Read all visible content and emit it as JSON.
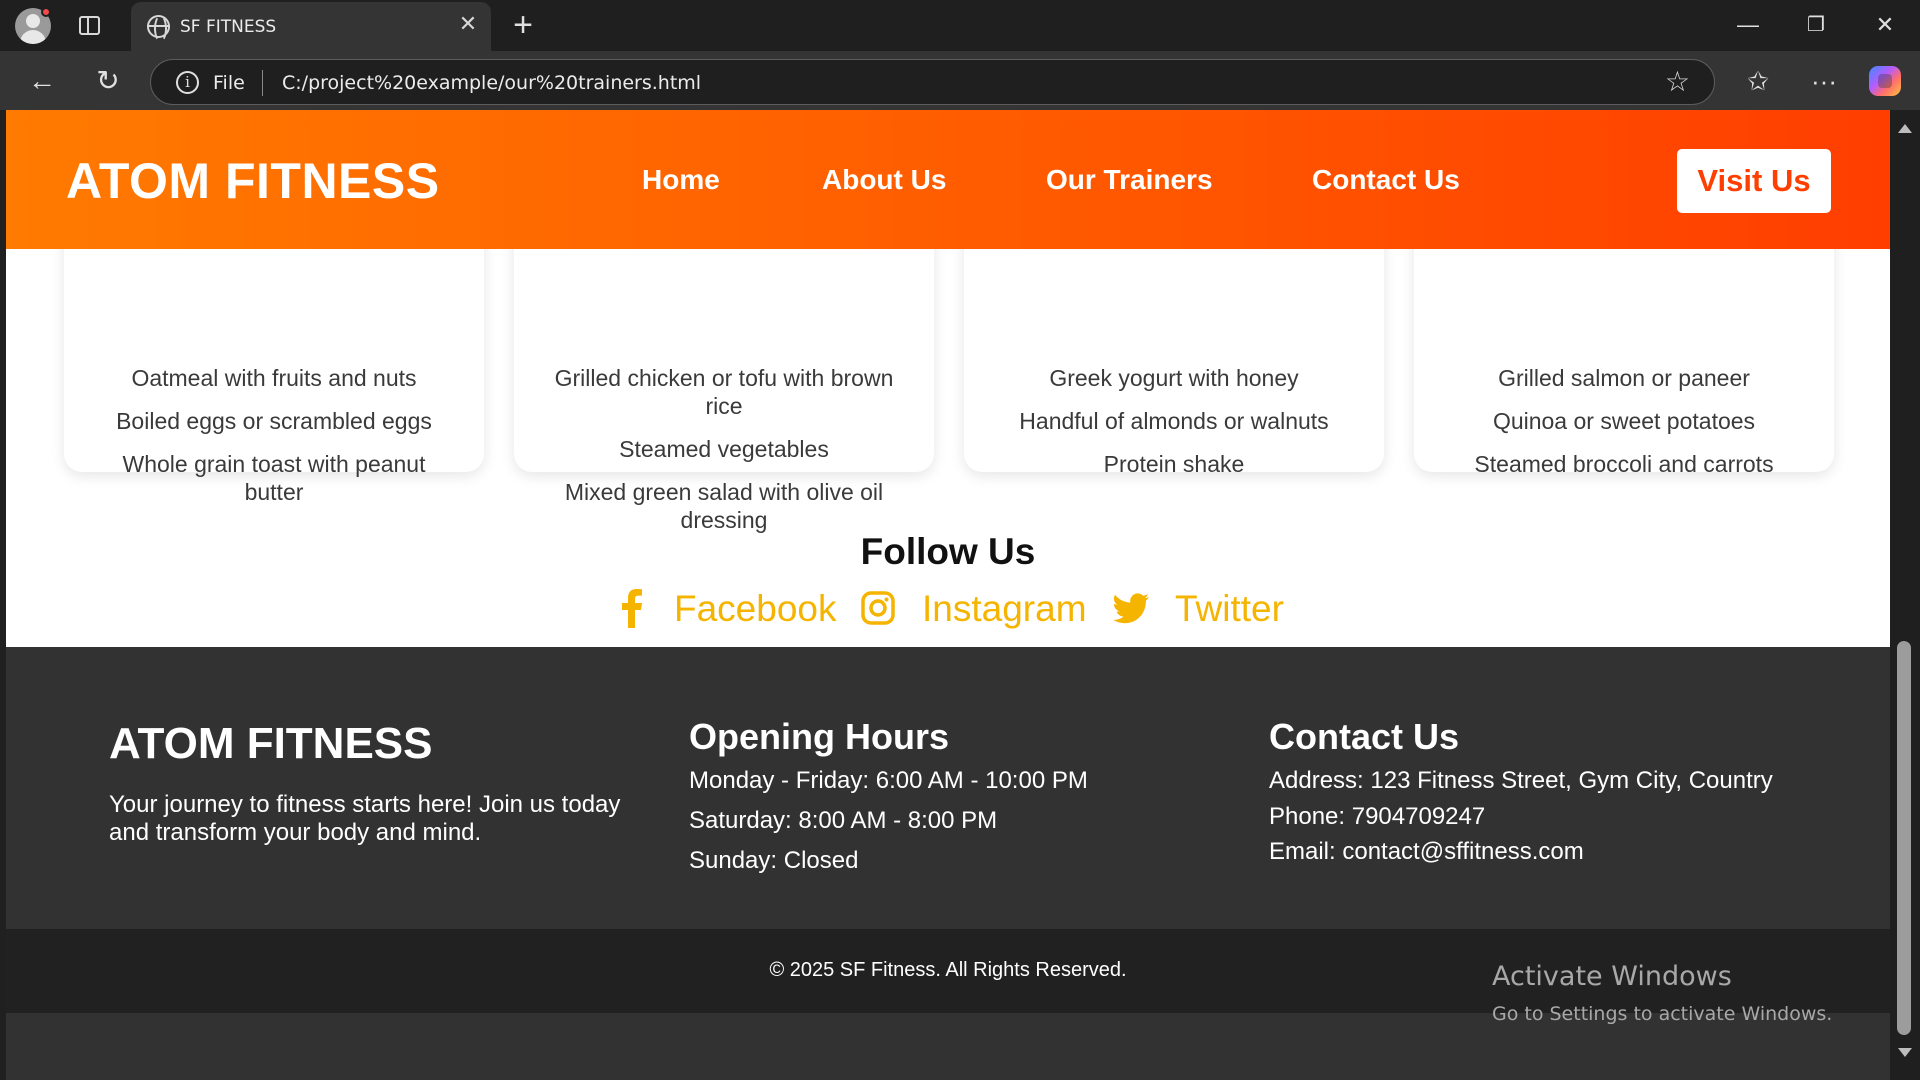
{
  "browser": {
    "tab_title": "SF FITNESS",
    "url_scheme": "File",
    "url": "C:/project%20example/our%20trainers.html"
  },
  "header": {
    "brand": "ATOM FITNESS",
    "nav": [
      "Home",
      "About Us",
      "Our Trainers",
      "Contact Us"
    ],
    "cta": "Visit Us"
  },
  "meal_cards": [
    {
      "items": [
        "Oatmeal with fruits and nuts",
        "Boiled eggs or scrambled eggs",
        "Whole grain toast with peanut butter"
      ]
    },
    {
      "items": [
        "Grilled chicken or tofu with brown rice",
        "Steamed vegetables",
        "Mixed green salad with olive oil dressing"
      ]
    },
    {
      "items": [
        "Greek yogurt with honey",
        "Handful of almonds or walnuts",
        "Protein shake"
      ]
    },
    {
      "items": [
        "Grilled salmon or paneer",
        "Quinoa or sweet potatoes",
        "Steamed broccoli and carrots"
      ]
    }
  ],
  "follow": {
    "title": "Follow Us",
    "links": [
      {
        "label": "Facebook",
        "icon": "facebook-icon"
      },
      {
        "label": "Instagram",
        "icon": "instagram-icon"
      },
      {
        "label": "Twitter",
        "icon": "twitter-icon"
      }
    ],
    "color": "#f5b400"
  },
  "footer": {
    "brand": "ATOM FITNESS",
    "tagline": "Your journey to fitness starts here! Join us today and transform your body and mind.",
    "hours_title": "Opening Hours",
    "hours": [
      "Monday - Friday: 6:00 AM - 10:00 PM",
      "Saturday: 8:00 AM - 8:00 PM",
      "Sunday: Closed"
    ],
    "contact_title": "Contact Us",
    "contact": [
      "Address: 123 Fitness Street, Gym City, Country",
      "Phone: 7904709247",
      "Email: contact@sffitness.com"
    ],
    "copyright": "© 2025 SF Fitness. All Rights Reserved."
  },
  "watermark": {
    "line1": "Activate Windows",
    "line2": "Go to Settings to activate Windows."
  },
  "colors": {
    "header_start": "#ff7a00",
    "header_end": "#ff3e00",
    "footer_bg": "#323232",
    "footer_bottom_bg": "#212121"
  }
}
